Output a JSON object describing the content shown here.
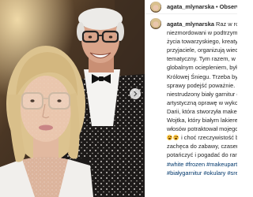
{
  "post": {
    "username": "agata_mlynarska",
    "separator": "•",
    "follow_label": "Obserwowanie",
    "caption": {
      "username": "agata_mlynarska",
      "lines": [
        "Raz w roku, na",
        "niezmordowani w podtrzymywan",
        "życia towarzyskiego, kreatywni",
        "przyjaciele, organizują wieczór",
        "tematyczny. Tym razem, w związk",
        "globalnym ociepleniem, był to b",
        "Królowej Śniegu. Trzeba było do",
        "sprawy podejść poważnie. Mój",
        "niestrudzony biały garnitur dost",
        "artystyczną oprawę w wykonani",
        "Darii, która stworzyła makeup i",
        "Wojtka, który białym lakierem d",
        "włosów potraktował mojego mę",
        "i choć rzeczywistość b",
        "zachęca do zabawy, czasem trzeba",
        "potańczyć i pogadać do rana..."
      ],
      "emoji_icons": [
        "laughing-face-emoji",
        "laughing-face-emoji"
      ]
    },
    "hashtags": [
      [
        "#white",
        "#frozen",
        "#makeupartist"
      ],
      [
        "#białygarnitur",
        "#okulary",
        "#srebro"
      ]
    ]
  },
  "icons": {
    "next_slide": "chevron-right-icon"
  },
  "colors": {
    "text": "#262626",
    "link": "#00376b",
    "divider": "#efefef"
  }
}
